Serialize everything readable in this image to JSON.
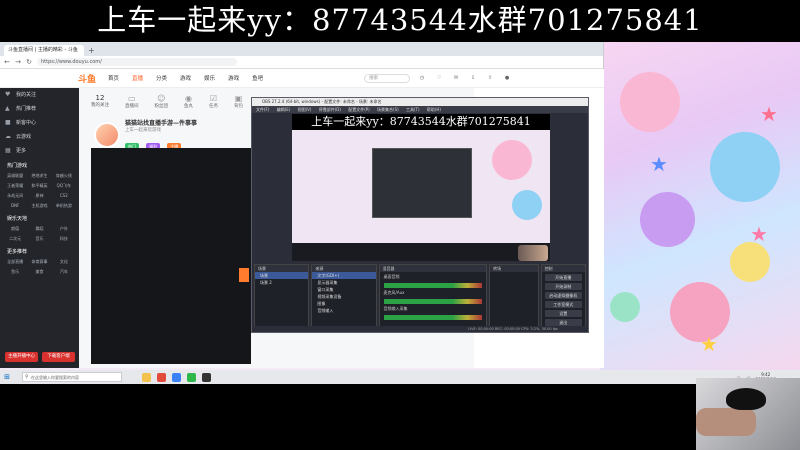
{
  "overlay": {
    "caption": "上车一起来yy：87743544水群701275841"
  },
  "browser": {
    "tab_label": "斗鱼直播间 | 主播的精彩 - 斗鱼",
    "url": "https://www.douyu.com/",
    "logo": "斗鱼",
    "nav": [
      "首页",
      "直播",
      "分类",
      "游戏",
      "娱乐",
      "游戏",
      "鱼吧"
    ],
    "search_placeholder": "搜索"
  },
  "sidebar": {
    "items": [
      "我的关注",
      "热门推荐",
      "新客中心",
      "云游戏",
      "更多"
    ],
    "section_hot": "热门游戏",
    "hot_games": [
      "英雄联盟",
      "绝地求生",
      "穿越火线",
      "王者荣耀",
      "和平精英",
      "QQ飞车",
      "永劫无间",
      "原神",
      "CS2",
      "DNF",
      "主机游戏",
      "单机热游"
    ],
    "section_ent": "娱乐天地",
    "ent_items": [
      "颜值",
      "舞蹈",
      "户外",
      "二次元",
      "音乐",
      "科技"
    ],
    "section_more": "更多推荐",
    "more_items": [
      "全部直播",
      "体育赛事",
      "文化",
      "鱼乐",
      "美食",
      "汽车"
    ],
    "btn_left": "主播开播中心",
    "btn_right": "下载客户端"
  },
  "main": {
    "stats": [
      {
        "num": "12",
        "label": "我的关注"
      },
      {
        "num": "",
        "label": "直播间"
      },
      {
        "num": "",
        "label": "粉丝团"
      },
      {
        "num": "",
        "label": "鱼丸"
      },
      {
        "num": "",
        "label": "任务"
      },
      {
        "num": "",
        "label": "背包"
      },
      {
        "num": "",
        "label": "更多"
      }
    ],
    "streamer_name": "猫猫站找直播手游—件事事",
    "streamer_meta": "上车一起来玩游戏",
    "chips": [
      "热门",
      "福利",
      "主播"
    ]
  },
  "obs": {
    "title": "OBS 27.2.4 (64-bit, windows) - 配置文件: 未命名 - 场景: 未命名",
    "menu": "文件(F) 编辑(E) 视图(V) 停靠部件(D) 配置文件(P) 场景集合(S) 工具(T) 帮助(H)",
    "preview_caption": "上车一起来yy：87743544水群701275841",
    "dock_scenes": "场景",
    "dock_sources": "来源",
    "dock_mixer": "混音器",
    "dock_transitions": "转场",
    "dock_controls": "控制",
    "scenes": [
      "场景",
      "场景 2"
    ],
    "sources": [
      "文字(GDI+)",
      "显示器采集",
      "窗口采集",
      "视频采集设备",
      "图像",
      "音频输入"
    ],
    "mixer": [
      "桌面音频",
      "麦克风/Aux",
      "音频输入采集"
    ],
    "controls": [
      "开始直播",
      "开始录制",
      "启动虚拟摄像机",
      "工作室模式",
      "设置",
      "退出"
    ],
    "status": "LIVE: 00:00:00  REC: 00:00:00  CPU: 3.2%, 30.00 fps"
  },
  "taskbar": {
    "search_placeholder": "在这里输入你要搜索的内容",
    "time": "9:42",
    "date": "2023/2/16"
  }
}
